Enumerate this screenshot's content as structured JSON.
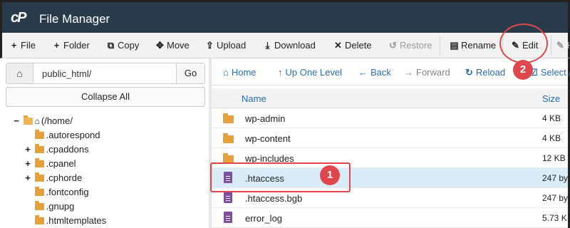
{
  "app": {
    "logo": "cP",
    "title": "File Manager"
  },
  "toolbar": {
    "file": "File",
    "folder": "Folder",
    "copy": "Copy",
    "move": "Move",
    "upload": "Upload",
    "download": "Download",
    "delete": "Delete",
    "restore": "Restore",
    "rename": "Rename",
    "edit": "Edit",
    "html_edit": "H"
  },
  "sidebar": {
    "path_value": "public_html/",
    "go": "Go",
    "collapse_all": "Collapse All",
    "tree": [
      {
        "label": "(/home/",
        "toggle": "−",
        "root": true
      },
      {
        "label": ".autorespond",
        "toggle": ""
      },
      {
        "label": ".cpaddons",
        "toggle": "+"
      },
      {
        "label": ".cpanel",
        "toggle": "+"
      },
      {
        "label": ".cphorde",
        "toggle": "+"
      },
      {
        "label": ".fontconfig",
        "toggle": ""
      },
      {
        "label": ".gnupg",
        "toggle": ""
      },
      {
        "label": ".htmltemplates",
        "toggle": ""
      }
    ]
  },
  "nav": {
    "home": "Home",
    "up": "Up One Level",
    "back": "Back",
    "forward": "Forward",
    "reload": "Reload",
    "select_all": "Select All"
  },
  "table": {
    "col_name": "Name",
    "col_size": "Size",
    "rows": [
      {
        "name": "wp-admin",
        "size": "4 KB",
        "type": "folder"
      },
      {
        "name": "wp-content",
        "size": "4 KB",
        "type": "folder"
      },
      {
        "name": "wp-includes",
        "size": "12 KB",
        "type": "folder"
      },
      {
        "name": ".htaccess",
        "size": "247 by",
        "type": "file",
        "selected": true
      },
      {
        "name": ".htaccess.bgb",
        "size": "247 by",
        "type": "file"
      },
      {
        "name": "error_log",
        "size": "5.73 K",
        "type": "file"
      }
    ]
  },
  "annotations": {
    "step1": "1",
    "step2": "2",
    "color": "#e0474c"
  }
}
